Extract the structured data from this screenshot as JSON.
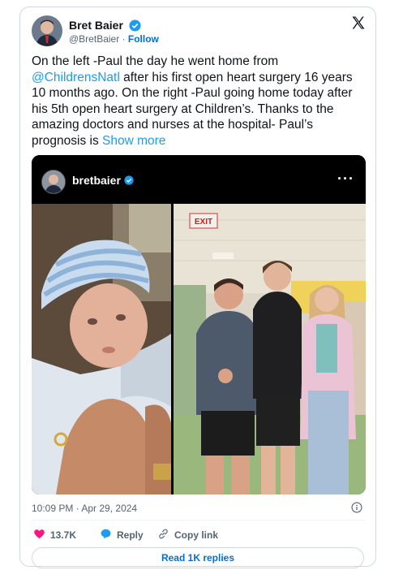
{
  "author": {
    "display_name": "Bret Baier",
    "handle": "@BretBaier",
    "separator": "·",
    "follow_label": "Follow"
  },
  "tweet": {
    "text_part1": "On the left -Paul the day he went home from ",
    "mention": "@ChildrensNatl",
    "text_part2": " after his first open heart surgery 16 years 10 months ago. On the right -Paul going home today after his 5th open heart surgery at Children’s. Thanks to the amazing doctors and nurses at the hospital- Paul’s prognosis is ",
    "show_more_label": "Show more"
  },
  "embed": {
    "username": "bretbaier",
    "more_label": "···",
    "exit_sign": "EXIT"
  },
  "meta": {
    "timestamp": "10:09 PM · Apr 29, 2024"
  },
  "actions": {
    "like_count": "13.7K",
    "reply_label": "Reply",
    "copy_label": "Copy link"
  },
  "replies_button_label": "Read 1K replies",
  "colors": {
    "accent": "#1d9bf0",
    "like": "#f91880",
    "muted": "#536471"
  }
}
